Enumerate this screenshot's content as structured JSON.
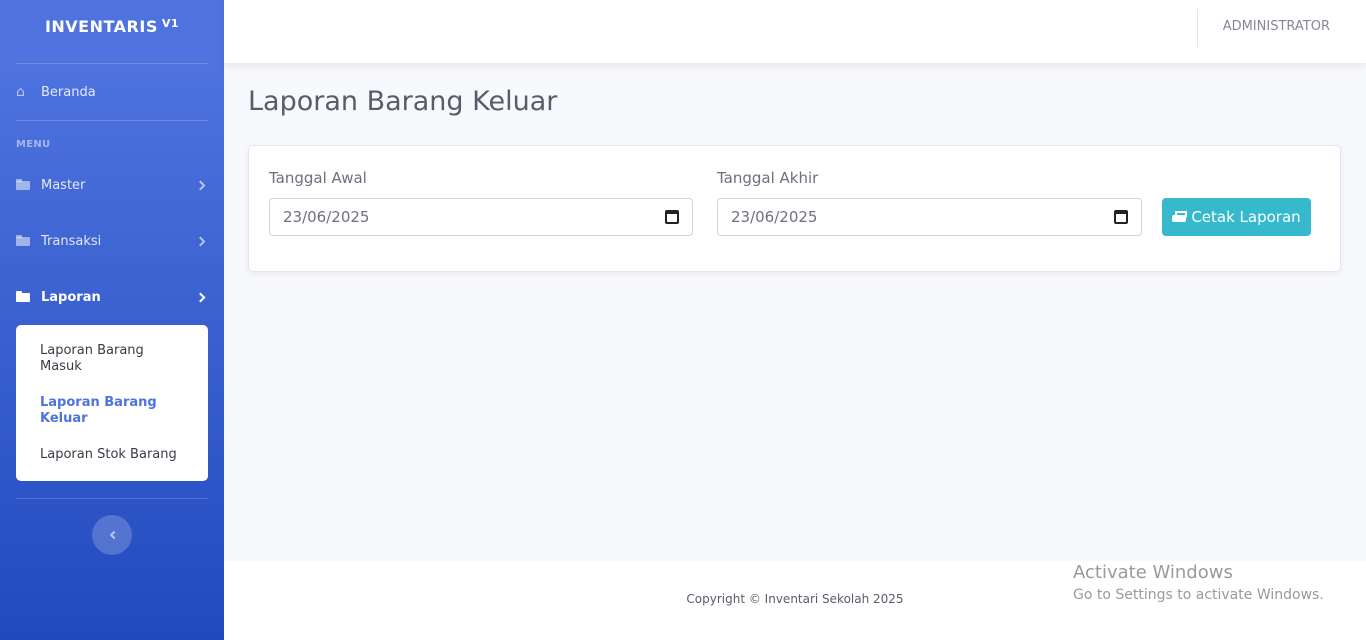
{
  "brand": {
    "name": "INVENTARIS",
    "version": "V1"
  },
  "sidebar": {
    "home_label": "Beranda",
    "heading": "MENU",
    "items": [
      {
        "label": "Master",
        "icon": "folder-icon"
      },
      {
        "label": "Transaksi",
        "icon": "folder-icon"
      },
      {
        "label": "Laporan",
        "icon": "folder-icon",
        "active": true
      }
    ],
    "submenu": [
      {
        "label": "Laporan Barang Masuk"
      },
      {
        "label": "Laporan Barang Keluar",
        "active": true
      },
      {
        "label": "Laporan Stok Barang"
      }
    ]
  },
  "topbar": {
    "user": "ADMINISTRATOR"
  },
  "page": {
    "title": "Laporan Barang Keluar"
  },
  "form": {
    "start_label": "Tanggal Awal",
    "start_value": "23/06/2025",
    "end_label": "Tanggal Akhir",
    "end_value": "23/06/2025",
    "print_label": "Cetak Laporan"
  },
  "footer": {
    "copyright": "Copyright © Inventari Sekolah 2025"
  },
  "watermark": {
    "title": "Activate Windows",
    "subtitle": "Go to Settings to activate Windows."
  },
  "colors": {
    "primary": "#4e73df",
    "info": "#36b9cc"
  }
}
